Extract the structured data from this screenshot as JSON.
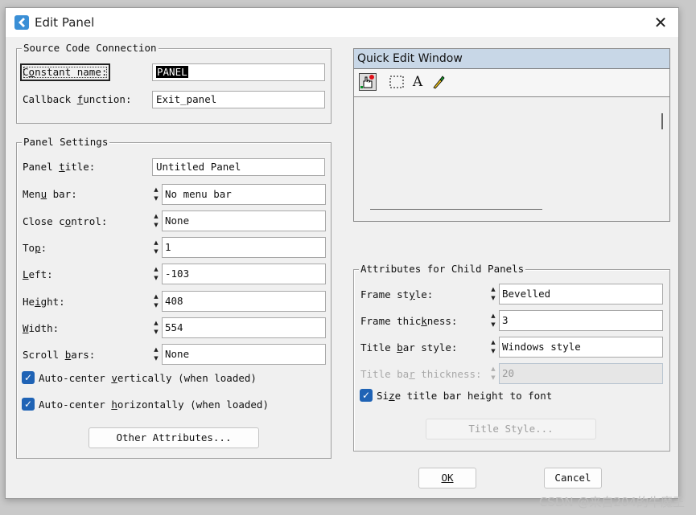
{
  "window": {
    "title": "Edit Panel",
    "close_glyph": "✕"
  },
  "source": {
    "legend": "Source Code Connection",
    "constant_pre": "C",
    "constant_ul": "o",
    "constant_post": "nstant name:",
    "constant_value": "PANEL",
    "callback_pre": "Callback ",
    "callback_ul": "f",
    "callback_post": "unction:",
    "callback_value": "Exit_panel"
  },
  "panel": {
    "legend": "Panel Settings",
    "title_pre": "Panel ",
    "title_ul": "t",
    "title_post": "itle:",
    "title_value": "Untitled Panel",
    "menubar_pre": "Men",
    "menubar_ul": "u",
    "menubar_post": " bar:",
    "menubar_value": "No menu bar",
    "close_pre": "Close c",
    "close_ul": "o",
    "close_post": "ntrol:",
    "close_value": "None",
    "top_pre": "To",
    "top_ul": "p",
    "top_post": ":",
    "top_value": "1",
    "left_pre": "",
    "left_ul": "L",
    "left_post": "eft:",
    "left_value": "-103",
    "height_pre": "He",
    "height_ul": "i",
    "height_post": "ght:",
    "height_value": "408",
    "width_pre": "",
    "width_ul": "W",
    "width_post": "idth:",
    "width_value": "554",
    "scroll_pre": "Scroll ",
    "scroll_ul": "b",
    "scroll_post": "ars:",
    "scroll_value": "None",
    "autov_pre": "Auto-center ",
    "autov_ul": "v",
    "autov_post": "ertically (when loaded)",
    "autoh_pre": "Auto-center ",
    "autoh_ul": "h",
    "autoh_post": "orizontally (when loaded)",
    "other_button": "Other Attributes..."
  },
  "quick_edit": {
    "title": "Quick Edit Window"
  },
  "child": {
    "legend": "Attributes for Child Panels",
    "frame_style_pre": "Frame st",
    "frame_style_ul": "y",
    "frame_style_post": "le:",
    "frame_style_value": "Bevelled",
    "frame_thick_pre": "Frame thic",
    "frame_thick_ul": "k",
    "frame_thick_post": "ness:",
    "frame_thick_value": "3",
    "titlebar_style_pre": "Title ",
    "titlebar_style_ul": "b",
    "titlebar_style_post": "ar style:",
    "titlebar_style_value": "Windows style",
    "titlebar_thick_pre": "Title ba",
    "titlebar_thick_ul": "r",
    "titlebar_thick_post": " thickness:",
    "titlebar_thick_value": "20",
    "size_pre": "Si",
    "size_ul": "z",
    "size_post": "e title bar height to font",
    "title_style_button": "Title Style..."
  },
  "buttons": {
    "ok": "OK",
    "cancel": "Cancel"
  },
  "watermark": "CSDN @来自204的牛魔王",
  "colors": {
    "accent": "#1f63b5",
    "quick_edit_title": "#c8d7e7"
  }
}
